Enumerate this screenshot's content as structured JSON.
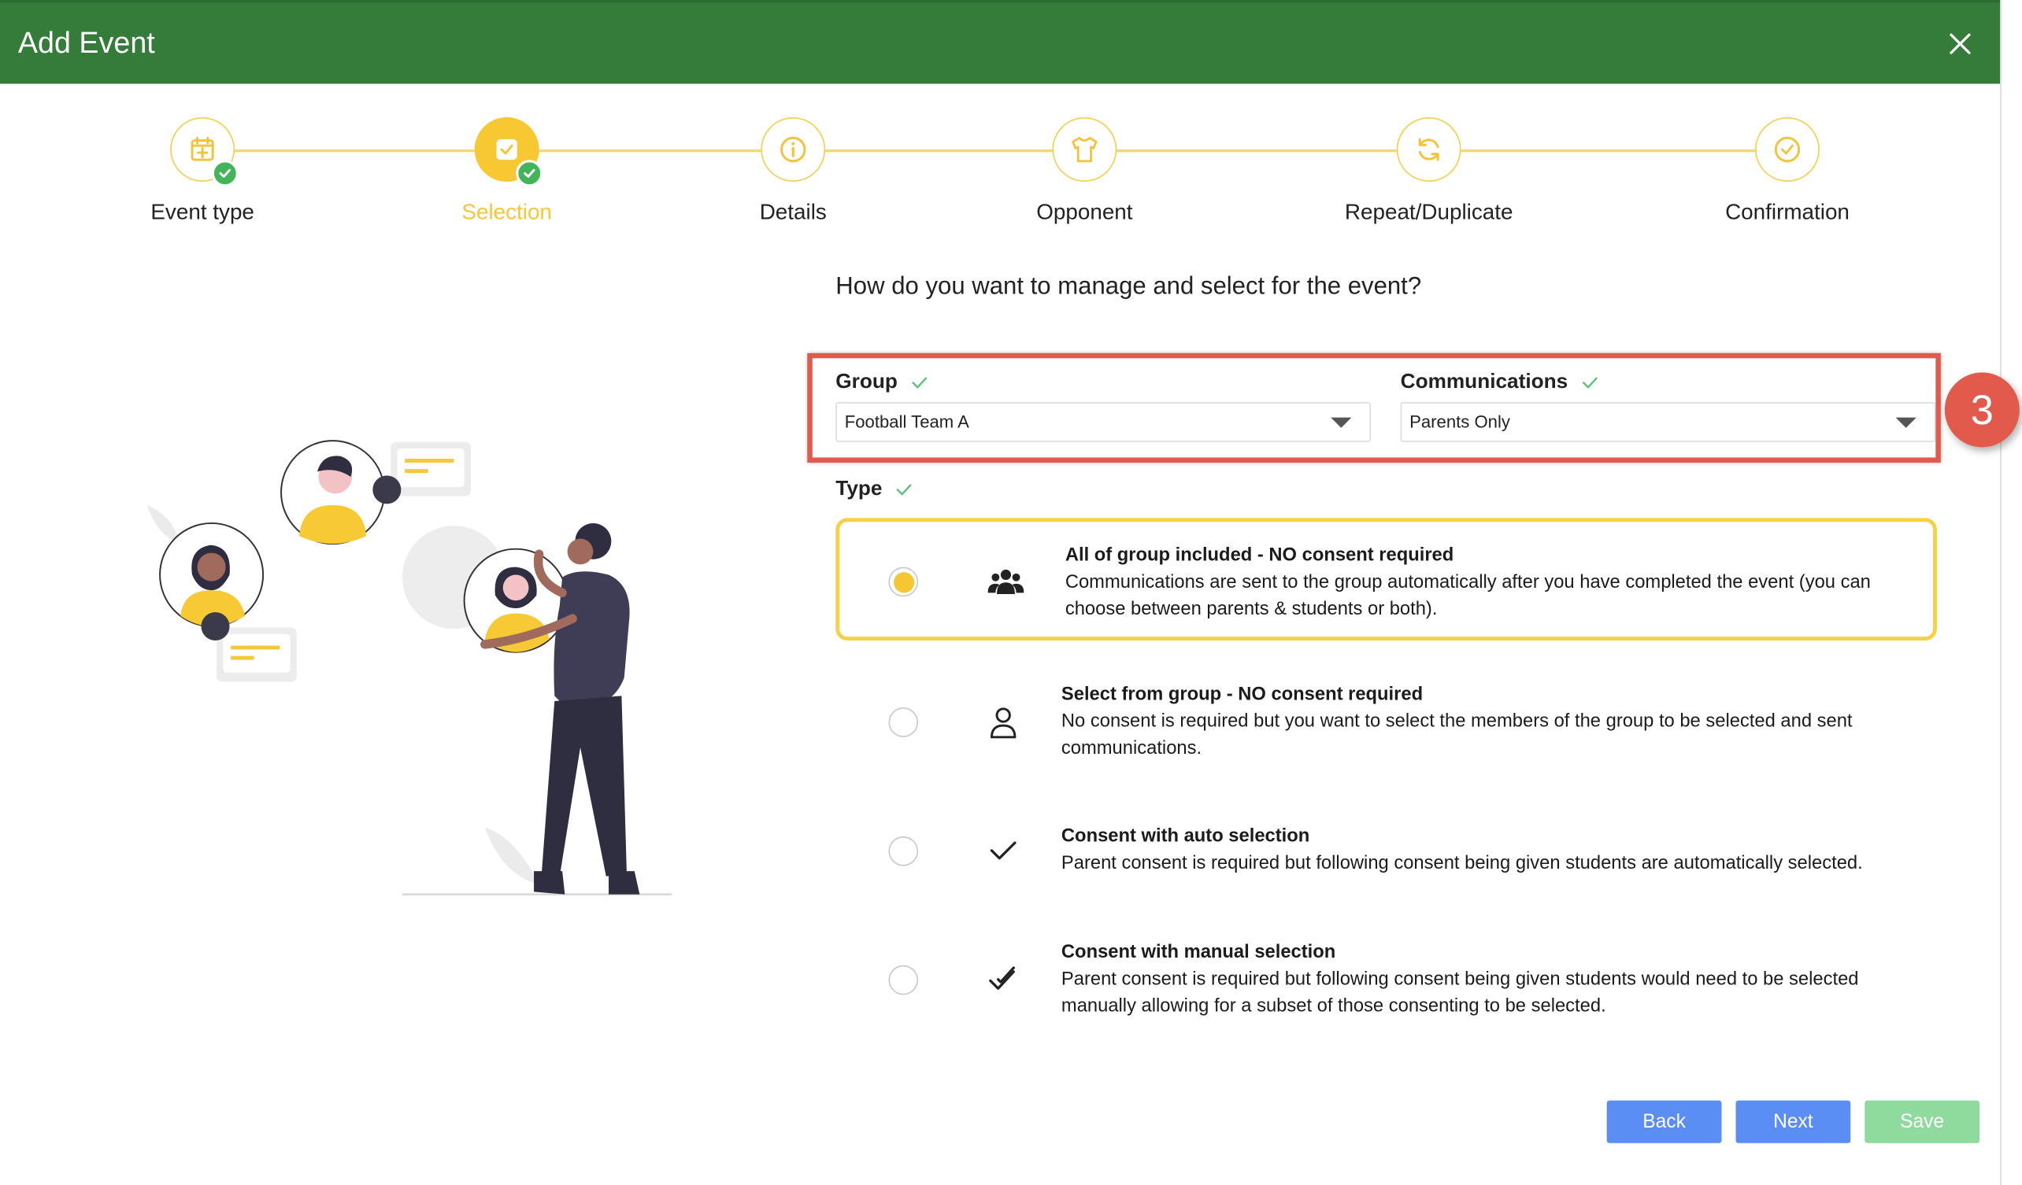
{
  "modal": {
    "title": "Add Event"
  },
  "steps": [
    {
      "label": "Event type",
      "icon": "calendar-plus-icon",
      "state": "completed"
    },
    {
      "label": "Selection",
      "icon": "checkbox-icon",
      "state": "active"
    },
    {
      "label": "Details",
      "icon": "info-icon",
      "state": "upcoming"
    },
    {
      "label": "Opponent",
      "icon": "shirt-icon",
      "state": "upcoming"
    },
    {
      "label": "Repeat/Duplicate",
      "icon": "refresh-icon",
      "state": "upcoming"
    },
    {
      "label": "Confirmation",
      "icon": "check-circle-icon",
      "state": "upcoming"
    }
  ],
  "question": "How do you want to manage and select for the event?",
  "group": {
    "label": "Group",
    "value": "Football Team A"
  },
  "communications": {
    "label": "Communications",
    "value": "Parents Only"
  },
  "annotation": {
    "badge": "3",
    "color": "#e25a4c"
  },
  "type": {
    "label": "Type",
    "options": [
      {
        "title": "All of group included - NO consent required",
        "description": "Communications are sent to the group automatically after you have completed the event (you can choose between parents & students or both).",
        "icon": "group-icon",
        "selected": true
      },
      {
        "title": "Select from group - NO consent required",
        "description": "No consent is required but you want to select the members of the group to be selected and sent communications.",
        "icon": "person-icon",
        "selected": false
      },
      {
        "title": "Consent with auto selection",
        "description": "Parent consent is required but following consent being given students are automatically selected.",
        "icon": "check-icon",
        "selected": false
      },
      {
        "title": "Consent with manual selection",
        "description": "Parent consent is required but following consent being given students would need to be selected manually allowing for a subset of those consenting to be selected.",
        "icon": "double-check-icon",
        "selected": false
      }
    ]
  },
  "buttons": {
    "back": "Back",
    "next": "Next",
    "save": "Save"
  },
  "colors": {
    "header": "#357c3a",
    "accent": "#f6c738",
    "primary_button": "#5a8ef5",
    "save_button": "#8fdb9e",
    "success": "#44b45a"
  }
}
